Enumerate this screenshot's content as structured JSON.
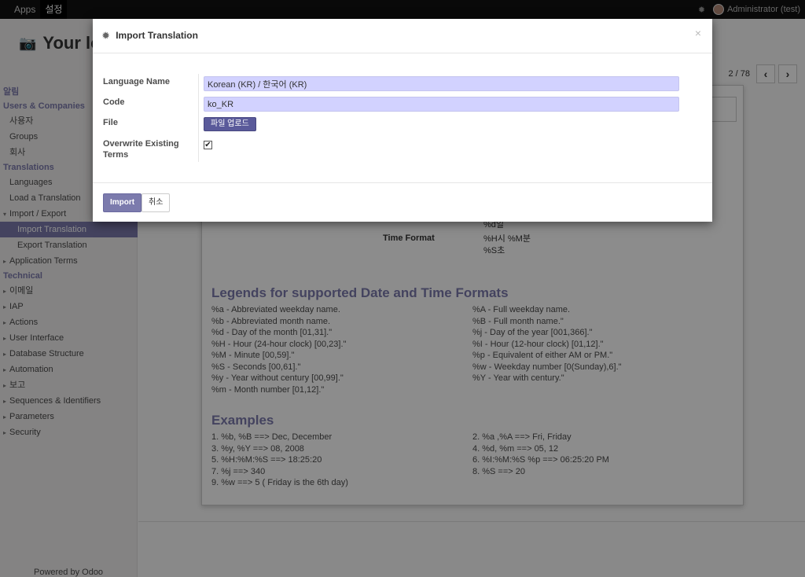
{
  "topbar": {
    "menu": [
      "Apps",
      "설정"
    ],
    "user": "Administrator (test)",
    "icons": [
      "bug-icon",
      "avatar"
    ]
  },
  "page": {
    "brand_text": "Your lo",
    "pager": {
      "count": "2 / 78",
      "prev": "‹",
      "next": "›"
    }
  },
  "sidebar": {
    "items": [
      {
        "type": "section",
        "label": "알림"
      },
      {
        "type": "section",
        "label": "Users & Companies"
      },
      {
        "type": "item",
        "label": "사용자"
      },
      {
        "type": "item",
        "label": "Groups"
      },
      {
        "type": "item",
        "label": "회사"
      },
      {
        "type": "section",
        "label": "Translations"
      },
      {
        "type": "item",
        "label": "Languages"
      },
      {
        "type": "item",
        "label": "Load a Translation"
      },
      {
        "type": "item",
        "label": "Import / Export",
        "caret": "down"
      },
      {
        "type": "sub",
        "label": "Import Translation",
        "active": true
      },
      {
        "type": "sub",
        "label": "Export Translation"
      },
      {
        "type": "item",
        "label": "Application Terms",
        "caret": "right"
      },
      {
        "type": "section",
        "label": "Technical"
      },
      {
        "type": "item",
        "label": "이메일",
        "caret": "right"
      },
      {
        "type": "item",
        "label": "IAP",
        "caret": "right"
      },
      {
        "type": "item",
        "label": "Actions",
        "caret": "right"
      },
      {
        "type": "item",
        "label": "User Interface",
        "caret": "right"
      },
      {
        "type": "item",
        "label": "Database Structure",
        "caret": "right"
      },
      {
        "type": "item",
        "label": "Automation",
        "caret": "right"
      },
      {
        "type": "item",
        "label": "보고",
        "caret": "right"
      },
      {
        "type": "item",
        "label": "Sequences & Identifiers",
        "caret": "right"
      },
      {
        "type": "item",
        "label": "Parameters",
        "caret": "right"
      },
      {
        "type": "item",
        "label": "Security",
        "caret": "right"
      }
    ],
    "powered_by": "Powered by Odoo"
  },
  "sheet": {
    "fragment": "%d일",
    "time_format_label": "Time Format",
    "time_format_value": [
      "%H시 %M분",
      "%S초"
    ],
    "legends_title": "Legends for supported Date and Time Formats",
    "legends": [
      [
        "%a - Abbreviated weekday name.",
        "%A - Full weekday name."
      ],
      [
        "%b - Abbreviated month name.",
        "%B - Full month name.\""
      ],
      [
        "%d - Day of the month [01,31].\"",
        "%j - Day of the year [001,366].\""
      ],
      [
        "%H - Hour (24-hour clock) [00,23].\"",
        "%I - Hour (12-hour clock) [01,12].\""
      ],
      [
        "%M - Minute [00,59].\"",
        "%p - Equivalent of either AM or PM.\""
      ],
      [
        "%S - Seconds [00,61].\"",
        "%w - Weekday number [0(Sunday),6].\""
      ],
      [
        "%y - Year without century [00,99].\"",
        "%Y - Year with century.\""
      ],
      [
        "%m - Month number [01,12].\"",
        ""
      ]
    ],
    "examples_title": "Examples",
    "examples": [
      [
        "1. %b, %B ==> Dec, December",
        "2. %a ,%A ==> Fri, Friday"
      ],
      [
        "3. %y, %Y ==> 08, 2008",
        "4. %d, %m ==> 05, 12"
      ],
      [
        "5. %H:%M:%S ==> 18:25:20",
        "6. %I:%M:%S %p ==> 06:25:20 PM"
      ],
      [
        "7. %j ==> 340",
        "8. %S ==> 20"
      ],
      [
        "9. %w ==> 5 ( Friday is the 6th day)",
        ""
      ]
    ]
  },
  "modal": {
    "title": "Import Translation",
    "close": "×",
    "fields": {
      "language_name_label": "Language Name",
      "language_name_value": "Korean (KR) / 한국어 (KR)",
      "code_label": "Code",
      "code_value": "ko_KR",
      "file_label": "File",
      "upload_label": "파일 업로드",
      "overwrite_label": "Overwrite Existing Terms",
      "overwrite_checked": true
    },
    "footer": {
      "import_label": "Import",
      "cancel_label": "취소"
    }
  },
  "colors": {
    "accent": "#7c7bad",
    "topbar": "#111111",
    "input_bg": "#d2d2ff",
    "upload_btn": "#5a5a9a"
  }
}
